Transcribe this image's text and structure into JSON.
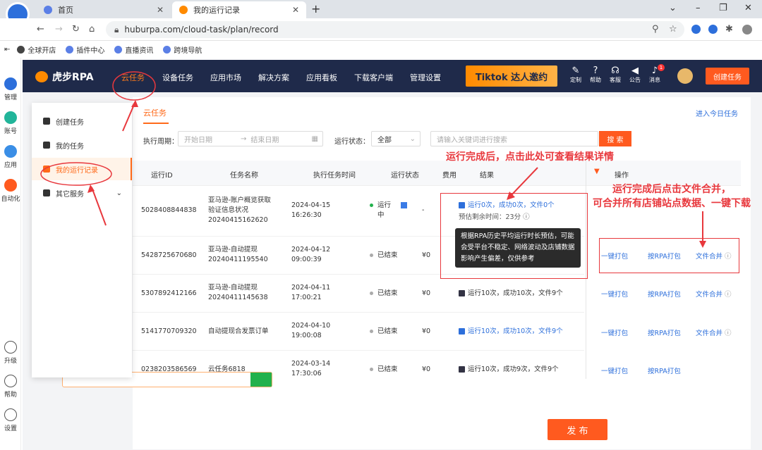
{
  "browser": {
    "tabs": [
      {
        "label": "首页"
      },
      {
        "label": "我的运行记录"
      }
    ],
    "url": "huburpa.com/cloud-task/plan/record",
    "bookmarks": [
      "全球开店",
      "插件中心",
      "直播资讯",
      "跨境导航"
    ]
  },
  "rail": [
    "管理",
    "账号",
    "应用",
    "自动化",
    "升级",
    "帮助",
    "设置"
  ],
  "header": {
    "logo": "虎步RPA",
    "nav": [
      "云任务",
      "设备任务",
      "应用市场",
      "解决方案",
      "应用看板",
      "下载客户端",
      "管理设置"
    ],
    "banner": "Tiktok 达人邀约",
    "icons": [
      {
        "label": "定制",
        "icon": "customize-icon"
      },
      {
        "label": "帮助",
        "icon": "help-icon"
      },
      {
        "label": "客服",
        "icon": "service-icon"
      },
      {
        "label": "公告",
        "icon": "announce-icon"
      },
      {
        "label": "消息",
        "icon": "message-icon",
        "badge": "1"
      }
    ],
    "create_btn": "创建任务"
  },
  "menu": [
    "创建任务",
    "我的任务",
    "我的运行记录",
    "其它服务"
  ],
  "subtab": "云任务",
  "top_link": "进入今日任务",
  "filters": {
    "period_label": "执行周期：",
    "start_ph": "开始日期",
    "end_ph": "结束日期",
    "status_label": "运行状态：",
    "status_val": "全部",
    "search_ph": "请输入关键词进行搜索",
    "search_btn": "搜 索"
  },
  "columns": [
    "运行ID",
    "任务名称",
    "执行任务时间",
    "运行状态",
    "费用",
    "结果",
    "操作"
  ],
  "rows": [
    {
      "id": "5028408844838",
      "name1": "亚马逊-账户概览获取",
      "name2": "验证信息状况",
      "name3": "20240415162620",
      "date": "2024-04-15",
      "time": "16:26:30",
      "status1": "运行",
      "status2": "中",
      "fee": "-",
      "result": "运行0次，成功0次，文件0个",
      "sub": "预估剩余时间：23分"
    },
    {
      "id": "5428725670680",
      "name1": "亚马逊-自动提现",
      "name2": "20240411195540",
      "name3": "",
      "date": "2024-04-12",
      "time": "09:00:39",
      "status1": "已结束",
      "status2": "",
      "fee": "¥0",
      "result": "",
      "sub": ""
    },
    {
      "id": "5307892412166",
      "name1": "亚马逊-自动提现",
      "name2": "20240411145638",
      "name3": "",
      "date": "2024-04-11",
      "time": "17:00:21",
      "status1": "已结束",
      "status2": "",
      "fee": "¥0",
      "result": "运行10次，成功10次，文件9个",
      "sub": ""
    },
    {
      "id": "5141770709320",
      "name1": "自动提现合发票订单",
      "name2": "",
      "name3": "",
      "date": "2024-04-10",
      "time": "19:00:08",
      "status1": "已结束",
      "status2": "",
      "fee": "¥0",
      "result": "运行10次，成功10次，文件9个",
      "sub": ""
    },
    {
      "id": "0238203586569",
      "name1": "云任务6818",
      "name2": "",
      "name3": "",
      "date": "2024-03-14",
      "time": "17:30:06",
      "status1": "已结束",
      "status2": "",
      "fee": "¥0",
      "result": "运行10次，成功9次，文件9个",
      "sub": ""
    }
  ],
  "ops": [
    [
      "一键打包",
      "按RPA打包",
      "文件合并"
    ],
    [
      "一键打包",
      "按RPA打包",
      "文件合并"
    ],
    [
      "一键打包",
      "按RPA打包",
      "文件合并"
    ],
    [
      "一键打包",
      "按RPA打包",
      ""
    ]
  ],
  "tooltip": "根据RPA历史平均运行时长预估，可能会受平台不稳定、网络波动及店铺数据影响产生偏差，仅供参考",
  "annot1": "运行完成后，点击此处可查看结果详情",
  "annot2a": "运行完成后点击文件合并，",
  "annot2b": "可合并所有店铺站点数据、一键下载",
  "publish": "发 布",
  "colors": {
    "accent": "#ff5a1f",
    "header": "#1f2a4a",
    "link": "#2d6fdb",
    "annotation": "#e8383d"
  }
}
